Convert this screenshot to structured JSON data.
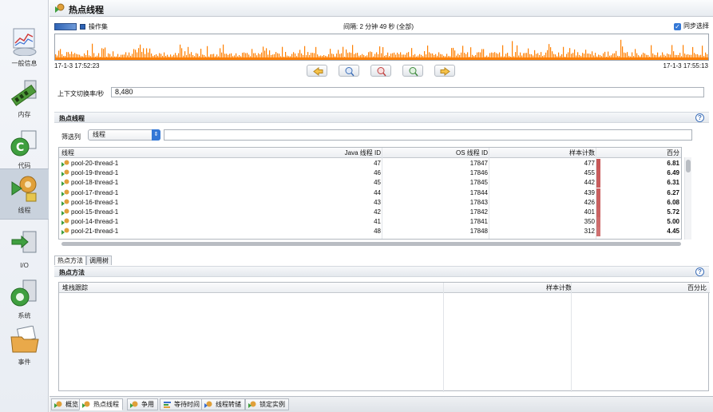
{
  "window": {
    "title": "热点线程"
  },
  "sidebar": {
    "items": [
      {
        "label": "一般信息",
        "icon": "chart-gauge-icon"
      },
      {
        "label": "内存",
        "icon": "memory-module-icon"
      },
      {
        "label": "代码",
        "icon": "code-icon"
      },
      {
        "label": "线程",
        "icon": "threads-gears-icon"
      },
      {
        "label": "I/O",
        "icon": "io-transfer-icon"
      },
      {
        "label": "系统",
        "icon": "system-computer-icon"
      },
      {
        "label": "事件",
        "icon": "event-folder-icon"
      }
    ]
  },
  "timeline": {
    "legend_label": "操作集",
    "interval": "间隔: 2 分钟 49 秒 (全部)",
    "sync_label": "同步选择",
    "start_time": "17-1-3 17:52:23",
    "end_time": "17-1-3 17:55:13",
    "accent": "#ff7f00"
  },
  "context": {
    "label": "上下文切换率/秒",
    "value": "8,480"
  },
  "hot_threads": {
    "title": "热点线程",
    "filter_label": "筛选列",
    "filter_value": "线程",
    "columns": [
      "线程",
      "Java 线程 ID",
      "OS 线程 ID",
      "样本计数",
      "百分"
    ],
    "rows": [
      {
        "name": "pool-20-thread-1",
        "java_id": "47",
        "os_id": "17847",
        "samples": "477",
        "percent": "6.81"
      },
      {
        "name": "pool-19-thread-1",
        "java_id": "46",
        "os_id": "17846",
        "samples": "455",
        "percent": "6.49"
      },
      {
        "name": "pool-18-thread-1",
        "java_id": "45",
        "os_id": "17845",
        "samples": "442",
        "percent": "6.31"
      },
      {
        "name": "pool-17-thread-1",
        "java_id": "44",
        "os_id": "17844",
        "samples": "439",
        "percent": "6.27"
      },
      {
        "name": "pool-16-thread-1",
        "java_id": "43",
        "os_id": "17843",
        "samples": "426",
        "percent": "6.08"
      },
      {
        "name": "pool-15-thread-1",
        "java_id": "42",
        "os_id": "17842",
        "samples": "401",
        "percent": "5.72"
      },
      {
        "name": "pool-14-thread-1",
        "java_id": "41",
        "os_id": "17841",
        "samples": "350",
        "percent": "5.00"
      },
      {
        "name": "pool-21-thread-1",
        "java_id": "48",
        "os_id": "17848",
        "samples": "312",
        "percent": "4.45"
      }
    ],
    "bar_color": "#c75656"
  },
  "subtabs": [
    "热点方法",
    "调用树"
  ],
  "hot_methods": {
    "title": "热点方法",
    "columns": [
      "堆栈跟踪",
      "样本计数",
      "百分比"
    ]
  },
  "bottom_tabs": [
    {
      "label": "概览",
      "icon": "overview-icon"
    },
    {
      "label": "热点线程",
      "icon": "hot-threads-icon"
    },
    {
      "label": "争用",
      "icon": "contention-icon"
    },
    {
      "label": "等待时间",
      "icon": "wait-time-icon"
    },
    {
      "label": "线程转储",
      "icon": "thread-dump-icon"
    },
    {
      "label": "锁定实例",
      "icon": "lock-instances-icon"
    }
  ]
}
